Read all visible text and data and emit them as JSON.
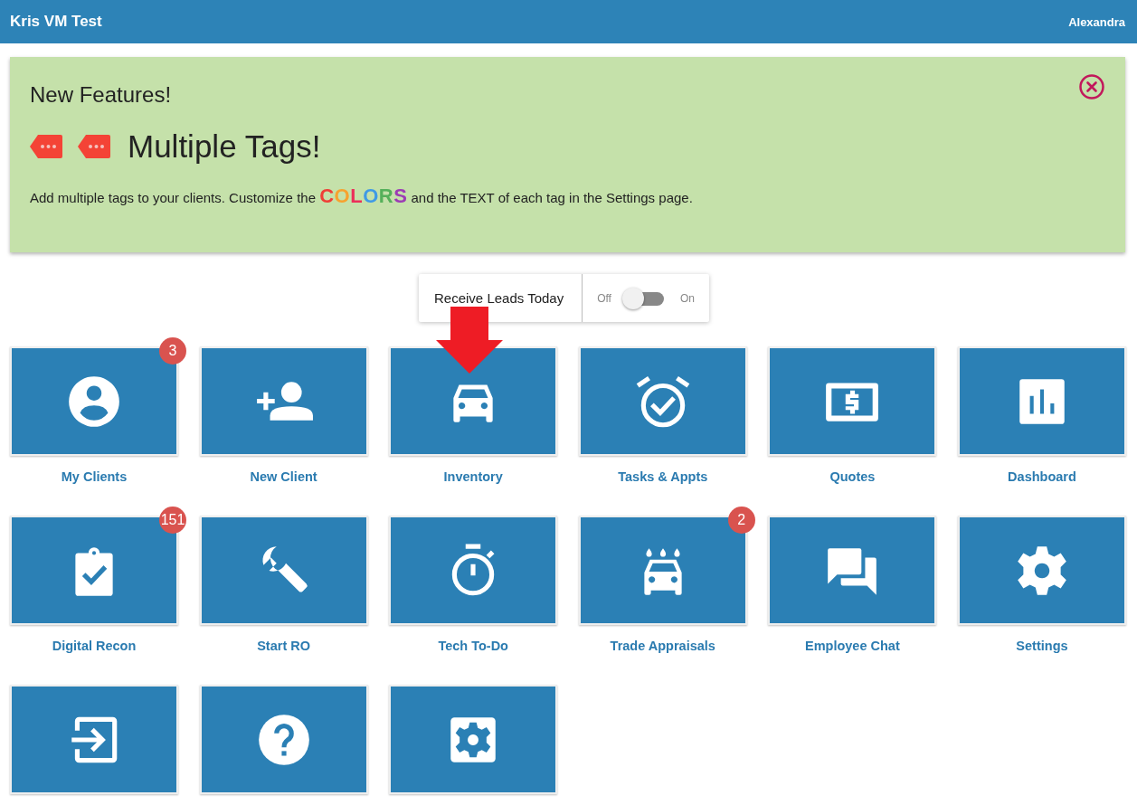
{
  "header": {
    "title": "Kris VM Test",
    "user": "Alexandra"
  },
  "banner": {
    "heading": "New Features!",
    "feature_title": "Multiple Tags!",
    "text_before": "Add multiple tags to your clients. Customize the",
    "colors_word": [
      {
        "letter": "C",
        "color": "#ef3e36"
      },
      {
        "letter": "O",
        "color": "#f7a22e"
      },
      {
        "letter": "L",
        "color": "#ec2f5a"
      },
      {
        "letter": "O",
        "color": "#3f9ae6"
      },
      {
        "letter": "R",
        "color": "#55b05a"
      },
      {
        "letter": "S",
        "color": "#9c3bb5"
      }
    ],
    "text_after": "and the TEXT of each tag in the Settings page."
  },
  "leads_toggle": {
    "label": "Receive Leads Today",
    "off_label": "Off",
    "on_label": "On",
    "on": false
  },
  "tiles": [
    {
      "kind": "person-circle",
      "label": "My Clients",
      "badge": "3",
      "arrow": false
    },
    {
      "kind": "person-add",
      "label": "New Client",
      "arrow": false
    },
    {
      "kind": "car",
      "label": "Inventory",
      "arrow": true
    },
    {
      "kind": "alarm",
      "label": "Tasks & Appts",
      "arrow": false
    },
    {
      "kind": "money",
      "label": "Quotes",
      "arrow": false
    },
    {
      "kind": "chart",
      "label": "Dashboard",
      "arrow": false
    },
    {
      "kind": "clipboard",
      "label": "Digital Recon",
      "badge": "151",
      "arrow": false
    },
    {
      "kind": "wrench",
      "label": "Start RO",
      "arrow": false
    },
    {
      "kind": "stopwatch",
      "label": "Tech To-Do",
      "arrow": false
    },
    {
      "kind": "carwash",
      "label": "Trade Appraisals",
      "badge": "2",
      "arrow": false
    },
    {
      "kind": "chat",
      "label": "Employee Chat",
      "arrow": false
    },
    {
      "kind": "gear",
      "label": "Settings",
      "arrow": false
    },
    {
      "kind": "login",
      "arrow": false
    },
    {
      "kind": "help",
      "arrow": false
    },
    {
      "kind": "gear-box",
      "arrow": false
    }
  ]
}
